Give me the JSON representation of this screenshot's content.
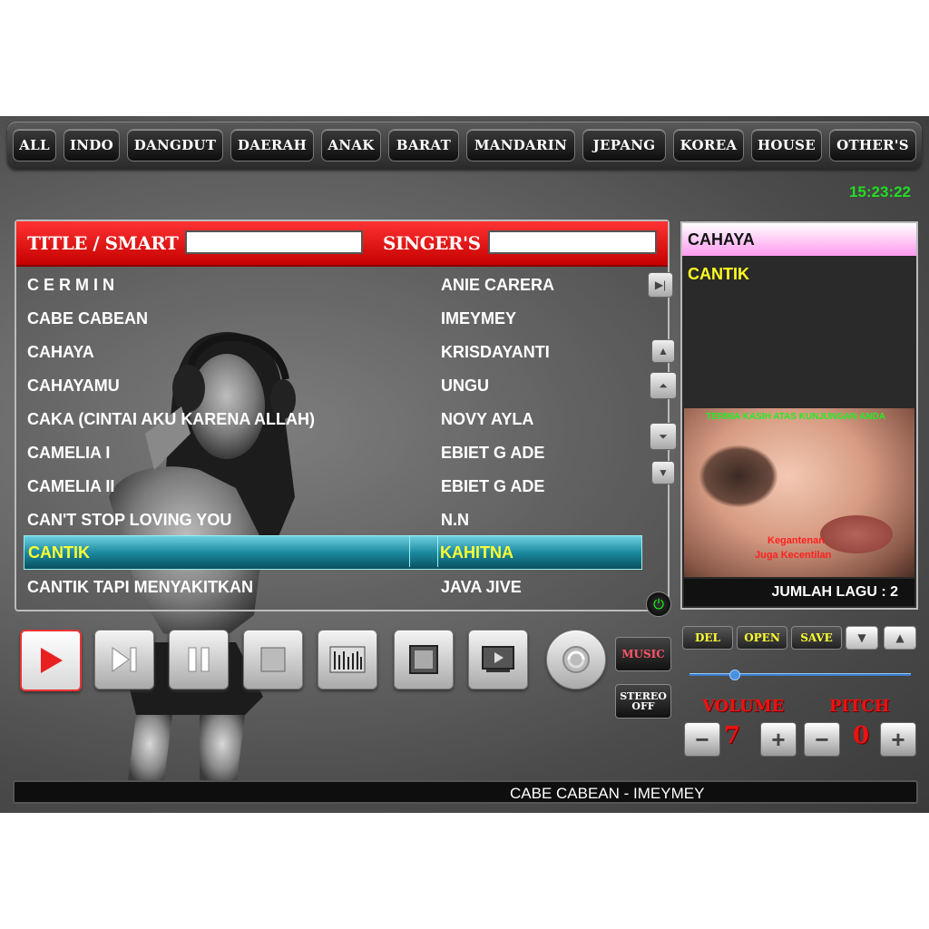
{
  "categories": [
    "ALL",
    "INDO",
    "DANGDUT",
    "DAERAH",
    "ANAK",
    "BARAT",
    "MANDARIN",
    "JEPANG",
    "KOREA",
    "HOUSE",
    "OTHER'S"
  ],
  "clock": "15:23:22",
  "search": {
    "title_label": "TITLE / SMART",
    "singer_label": "SINGER'S"
  },
  "songs": [
    {
      "title": "C E R M I N",
      "singer": "ANIE CARERA"
    },
    {
      "title": "CABE CABEAN",
      "singer": "IMEYMEY"
    },
    {
      "title": "CAHAYA",
      "singer": "KRISDAYANTI"
    },
    {
      "title": "CAHAYAMU",
      "singer": "UNGU"
    },
    {
      "title": "CAKA (CINTAI AKU KARENA ALLAH)",
      "singer": "NOVY AYLA"
    },
    {
      "title": "CAMELIA I",
      "singer": "EBIET G ADE"
    },
    {
      "title": "CAMELIA II",
      "singer": "EBIET G ADE"
    },
    {
      "title": "CAN'T STOP LOVING YOU",
      "singer": "N.N"
    },
    {
      "title": "CANTIK",
      "singer": "KAHITNA",
      "selected": true
    },
    {
      "title": "CANTIK TAPI MENYAKITKAN",
      "singer": "JAVA JIVE"
    }
  ],
  "queue": [
    "CAHAYA",
    "CANTIK"
  ],
  "video": {
    "marquee": "TERIMA KASIH ATAS KUNJUNGAN ANDA",
    "lyric_line1": "Kegantenan",
    "lyric_line2": "Juga Kecentilan"
  },
  "jumlah_lagu": "JUMLAH LAGU : 2",
  "queue_buttons": [
    "DEL",
    "OPEN",
    "SAVE"
  ],
  "music_button": "MUSIC",
  "stereo_button": "STEREO OFF",
  "volume": {
    "label": "VOLUME",
    "value": "7"
  },
  "pitch": {
    "label": "PITCH",
    "value": "0"
  },
  "now_playing": "CABE CABEAN - IMEYMEY",
  "colors": {
    "accent_red": "#e01010",
    "clock_green": "#22dd22",
    "selected_text": "#ffff33",
    "selected_bg": "#1c8aa0"
  }
}
